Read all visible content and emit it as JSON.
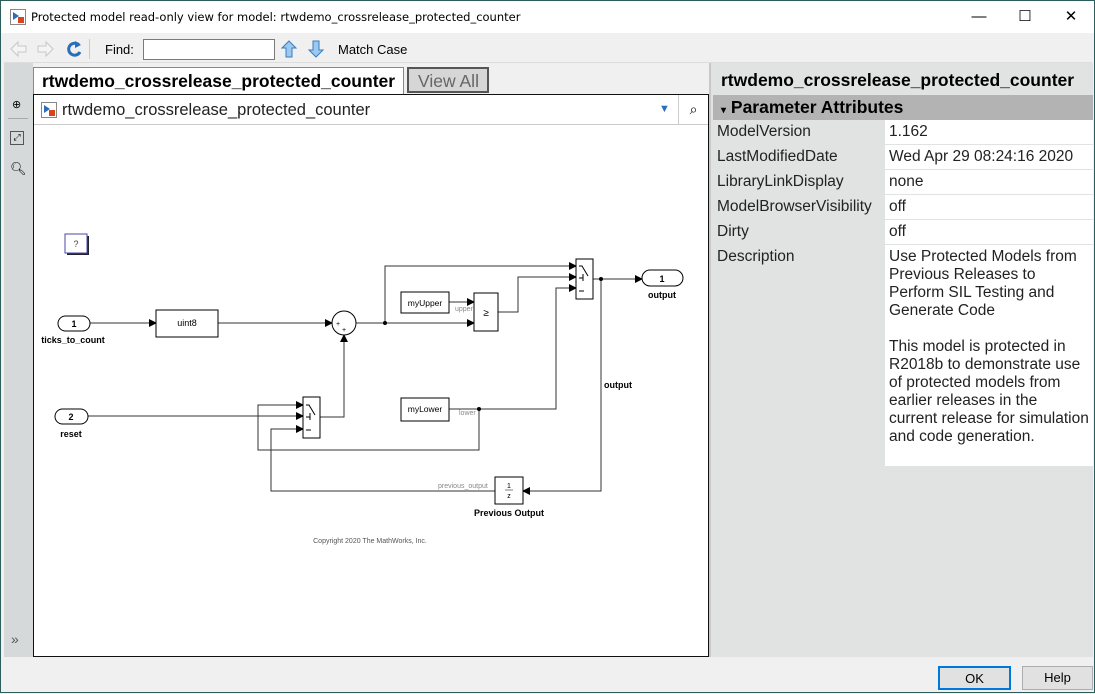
{
  "window": {
    "title": "Protected model read-only view for model: rtwdemo_crossrelease_protected_counter",
    "minimize": "—",
    "maximize": "☐",
    "close": "✕"
  },
  "toolbar": {
    "find_label": "Find:",
    "find_value": "",
    "match_case": "Match Case"
  },
  "tabs": [
    {
      "label": "rtwdemo_crossrelease_protected_counter"
    },
    {
      "label": "View All"
    }
  ],
  "breadcrumb": {
    "model": "rtwdemo_crossrelease_protected_counter"
  },
  "diagram": {
    "help_block": "?",
    "inport1": {
      "num": "1",
      "name": "ticks_to_count"
    },
    "inport2": {
      "num": "2",
      "name": "reset"
    },
    "convert": "uint8",
    "sum_signs": [
      "+",
      "+"
    ],
    "my_upper": "myUpper",
    "upper_label": "upper",
    "compare": "≥",
    "my_lower": "myLower",
    "lower_label": "lower",
    "outport": {
      "num": "1",
      "name": "output"
    },
    "output_signal": "output",
    "delay": {
      "num": "1",
      "den": "z",
      "name": "Previous Output",
      "signal": "previous_output"
    },
    "copyright": "Copyright 2020 The MathWorks, Inc."
  },
  "panel": {
    "title": "rtwdemo_crossrelease_protected_counter",
    "section": "Parameter Attributes",
    "rows": [
      {
        "key": "ModelVersion",
        "value": "1.162"
      },
      {
        "key": "LastModifiedDate",
        "value": "Wed Apr 29 08:24:16 2020"
      },
      {
        "key": "LibraryLinkDisplay",
        "value": "none"
      },
      {
        "key": "ModelBrowserVisibility",
        "value": "off"
      },
      {
        "key": "Dirty",
        "value": "off"
      },
      {
        "key": "Description",
        "value": "Use Protected Models from Previous Releases to Perform SIL Testing and Generate Code",
        "value2": "This model is protected in R2018b to demonstrate use of protected models from earlier releases in the current release for simulation and code generation."
      }
    ]
  },
  "buttons": {
    "ok": "OK",
    "help": "Help"
  },
  "colors": {
    "accent": "#0078d7",
    "header": "#b3b3b3"
  }
}
